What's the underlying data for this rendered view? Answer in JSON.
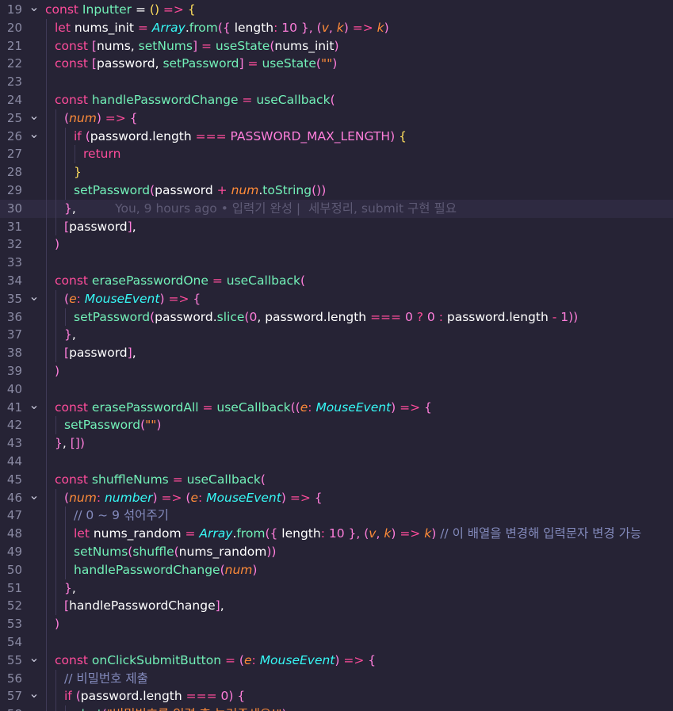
{
  "editor": {
    "blame": {
      "line": 30,
      "text": "You, 9 hours ago • 입력기 완성 |  세부정리, submit 구현 필요"
    },
    "lines": [
      {
        "n": 19,
        "fold": true,
        "indent": 0,
        "tokens": [
          [
            "k",
            "const "
          ],
          [
            "fn",
            "Inputter"
          ],
          [
            "v",
            " = "
          ],
          [
            "y",
            "()"
          ],
          [
            "k",
            " => "
          ],
          [
            "y",
            "{"
          ]
        ]
      },
      {
        "n": 20,
        "fold": false,
        "indent": 1,
        "tokens": [
          [
            "k",
            "let "
          ],
          [
            "v",
            "nums_init "
          ],
          [
            "k",
            "= "
          ],
          [
            "cls",
            "Array"
          ],
          [
            "v",
            "."
          ],
          [
            "fn",
            "from"
          ],
          [
            "pr",
            "({ "
          ],
          [
            "v",
            "length"
          ],
          [
            "k",
            ": "
          ],
          [
            "pr",
            "10 "
          ],
          [
            "pr",
            "}, "
          ],
          [
            "pr",
            "("
          ],
          [
            "p",
            "v"
          ],
          [
            "pr",
            ", "
          ],
          [
            "p",
            "k"
          ],
          [
            "pr",
            ")"
          ],
          [
            "k",
            " => "
          ],
          [
            "p",
            "k"
          ],
          [
            "pr",
            ")"
          ]
        ]
      },
      {
        "n": 21,
        "fold": false,
        "indent": 1,
        "tokens": [
          [
            "k",
            "const "
          ],
          [
            "pr",
            "["
          ],
          [
            "v",
            "nums, "
          ],
          [
            "fn",
            "setNums"
          ],
          [
            "pr",
            "]"
          ],
          [
            "k",
            " = "
          ],
          [
            "fn",
            "useState"
          ],
          [
            "pr",
            "("
          ],
          [
            "v",
            "nums_init"
          ],
          [
            "pr",
            ")"
          ]
        ]
      },
      {
        "n": 22,
        "fold": false,
        "indent": 1,
        "tokens": [
          [
            "k",
            "const "
          ],
          [
            "pr",
            "["
          ],
          [
            "v",
            "password, "
          ],
          [
            "fn",
            "setPassword"
          ],
          [
            "pr",
            "]"
          ],
          [
            "k",
            " = "
          ],
          [
            "fn",
            "useState"
          ],
          [
            "pr",
            "("
          ],
          [
            "s",
            "\"\""
          ],
          [
            "pr",
            ")"
          ]
        ]
      },
      {
        "n": 23,
        "fold": false,
        "indent": 1,
        "tokens": []
      },
      {
        "n": 24,
        "fold": false,
        "indent": 1,
        "tokens": [
          [
            "k",
            "const "
          ],
          [
            "fn",
            "handlePasswordChange"
          ],
          [
            "k",
            " = "
          ],
          [
            "fn",
            "useCallback"
          ],
          [
            "pr",
            "("
          ]
        ]
      },
      {
        "n": 25,
        "fold": true,
        "indent": 2,
        "tokens": [
          [
            "pr",
            "("
          ],
          [
            "p",
            "num"
          ],
          [
            "pr",
            ")"
          ],
          [
            "k",
            " => "
          ],
          [
            "pr",
            "{"
          ]
        ]
      },
      {
        "n": 26,
        "fold": true,
        "indent": 3,
        "tokens": [
          [
            "k",
            "if "
          ],
          [
            "pr",
            "("
          ],
          [
            "v",
            "password."
          ],
          [
            "v",
            "length"
          ],
          [
            "k",
            " === "
          ],
          [
            "pr",
            "PASSWORD_MAX_LENGTH"
          ],
          [
            "pr",
            ")"
          ],
          [
            "v",
            " "
          ],
          [
            "y",
            "{"
          ]
        ]
      },
      {
        "n": 27,
        "fold": false,
        "indent": 4,
        "tokens": [
          [
            "k",
            "return"
          ]
        ]
      },
      {
        "n": 28,
        "fold": false,
        "indent": 3,
        "tokens": [
          [
            "y",
            "}"
          ]
        ]
      },
      {
        "n": 29,
        "fold": false,
        "indent": 3,
        "tokens": [
          [
            "fn",
            "setPassword"
          ],
          [
            "pr",
            "("
          ],
          [
            "v",
            "password "
          ],
          [
            "k",
            "+ "
          ],
          [
            "p",
            "num"
          ],
          [
            "v",
            "."
          ],
          [
            "fn",
            "toString"
          ],
          [
            "pr",
            "())"
          ]
        ]
      },
      {
        "n": 30,
        "fold": false,
        "indent": 2,
        "tokens": [
          [
            "pr",
            "}"
          ],
          [
            "v",
            ","
          ]
        ]
      },
      {
        "n": 31,
        "fold": false,
        "indent": 2,
        "tokens": [
          [
            "pr",
            "["
          ],
          [
            "v",
            "password"
          ],
          [
            "pr",
            "]"
          ],
          [
            "v",
            ","
          ]
        ]
      },
      {
        "n": 32,
        "fold": false,
        "indent": 1,
        "tokens": [
          [
            "pr",
            ")"
          ]
        ]
      },
      {
        "n": 33,
        "fold": false,
        "indent": 1,
        "tokens": []
      },
      {
        "n": 34,
        "fold": false,
        "indent": 1,
        "tokens": [
          [
            "k",
            "const "
          ],
          [
            "fn",
            "erasePasswordOne"
          ],
          [
            "k",
            " = "
          ],
          [
            "fn",
            "useCallback"
          ],
          [
            "pr",
            "("
          ]
        ]
      },
      {
        "n": 35,
        "fold": true,
        "indent": 2,
        "tokens": [
          [
            "pr",
            "("
          ],
          [
            "p",
            "e"
          ],
          [
            "k",
            ": "
          ],
          [
            "cls",
            "MouseEvent"
          ],
          [
            "pr",
            ")"
          ],
          [
            "k",
            " => "
          ],
          [
            "pr",
            "{"
          ]
        ]
      },
      {
        "n": 36,
        "fold": false,
        "indent": 3,
        "tokens": [
          [
            "fn",
            "setPassword"
          ],
          [
            "pr",
            "("
          ],
          [
            "v",
            "password."
          ],
          [
            "fn",
            "slice"
          ],
          [
            "pr",
            "("
          ],
          [
            "pr",
            "0"
          ],
          [
            "v",
            ", password.length "
          ],
          [
            "k",
            "=== "
          ],
          [
            "pr",
            "0 "
          ],
          [
            "k",
            "? "
          ],
          [
            "pr",
            "0 "
          ],
          [
            "k",
            ": "
          ],
          [
            "v",
            "password.length "
          ],
          [
            "k",
            "- "
          ],
          [
            "pr",
            "1"
          ],
          [
            "pr",
            "))"
          ]
        ]
      },
      {
        "n": 37,
        "fold": false,
        "indent": 2,
        "tokens": [
          [
            "pr",
            "}"
          ],
          [
            "v",
            ","
          ]
        ]
      },
      {
        "n": 38,
        "fold": false,
        "indent": 2,
        "tokens": [
          [
            "pr",
            "["
          ],
          [
            "v",
            "password"
          ],
          [
            "pr",
            "]"
          ],
          [
            "v",
            ","
          ]
        ]
      },
      {
        "n": 39,
        "fold": false,
        "indent": 1,
        "tokens": [
          [
            "pr",
            ")"
          ]
        ]
      },
      {
        "n": 40,
        "fold": false,
        "indent": 1,
        "tokens": []
      },
      {
        "n": 41,
        "fold": true,
        "indent": 1,
        "tokens": [
          [
            "k",
            "const "
          ],
          [
            "fn",
            "erasePasswordAll"
          ],
          [
            "k",
            " = "
          ],
          [
            "fn",
            "useCallback"
          ],
          [
            "pr",
            "(("
          ],
          [
            "p",
            "e"
          ],
          [
            "k",
            ": "
          ],
          [
            "cls",
            "MouseEvent"
          ],
          [
            "pr",
            ")"
          ],
          [
            "k",
            " => "
          ],
          [
            "pr",
            "{"
          ]
        ]
      },
      {
        "n": 42,
        "fold": false,
        "indent": 2,
        "tokens": [
          [
            "fn",
            "setPassword"
          ],
          [
            "pr",
            "("
          ],
          [
            "s",
            "\"\""
          ],
          [
            "pr",
            ")"
          ]
        ]
      },
      {
        "n": 43,
        "fold": false,
        "indent": 1,
        "tokens": [
          [
            "pr",
            "}"
          ],
          [
            "v",
            ", "
          ],
          [
            "pr",
            "[])"
          ]
        ]
      },
      {
        "n": 44,
        "fold": false,
        "indent": 1,
        "tokens": []
      },
      {
        "n": 45,
        "fold": false,
        "indent": 1,
        "tokens": [
          [
            "k",
            "const "
          ],
          [
            "fn",
            "shuffleNums"
          ],
          [
            "k",
            " = "
          ],
          [
            "fn",
            "useCallback"
          ],
          [
            "pr",
            "("
          ]
        ]
      },
      {
        "n": 46,
        "fold": true,
        "indent": 2,
        "tokens": [
          [
            "pr",
            "("
          ],
          [
            "p",
            "num"
          ],
          [
            "k",
            ": "
          ],
          [
            "cls",
            "number"
          ],
          [
            "pr",
            ")"
          ],
          [
            "k",
            " => "
          ],
          [
            "pr",
            "("
          ],
          [
            "p",
            "e"
          ],
          [
            "k",
            ": "
          ],
          [
            "cls",
            "MouseEvent"
          ],
          [
            "pr",
            ")"
          ],
          [
            "k",
            " => "
          ],
          [
            "pr",
            "{"
          ]
        ]
      },
      {
        "n": 47,
        "fold": false,
        "indent": 3,
        "tokens": [
          [
            "c",
            "// 0 ~ 9 섞어주기"
          ]
        ]
      },
      {
        "n": 48,
        "fold": false,
        "indent": 3,
        "tokens": [
          [
            "k",
            "let "
          ],
          [
            "v",
            "nums_random "
          ],
          [
            "k",
            "= "
          ],
          [
            "cls",
            "Array"
          ],
          [
            "v",
            "."
          ],
          [
            "fn",
            "from"
          ],
          [
            "pr",
            "({ "
          ],
          [
            "v",
            "length"
          ],
          [
            "k",
            ": "
          ],
          [
            "pr",
            "10 "
          ],
          [
            "pr",
            "}, "
          ],
          [
            "pr",
            "("
          ],
          [
            "p",
            "v"
          ],
          [
            "pr",
            ", "
          ],
          [
            "p",
            "k"
          ],
          [
            "pr",
            ")"
          ],
          [
            "k",
            " => "
          ],
          [
            "p",
            "k"
          ],
          [
            "pr",
            ")"
          ],
          [
            "c",
            " // 이 배열을 변경해 입력문자 변경 가능"
          ]
        ]
      },
      {
        "n": 49,
        "fold": false,
        "indent": 3,
        "tokens": [
          [
            "fn",
            "setNums"
          ],
          [
            "pr",
            "("
          ],
          [
            "fn",
            "shuffle"
          ],
          [
            "pr",
            "("
          ],
          [
            "v",
            "nums_random"
          ],
          [
            "pr",
            "))"
          ]
        ]
      },
      {
        "n": 50,
        "fold": false,
        "indent": 3,
        "tokens": [
          [
            "fn",
            "handlePasswordChange"
          ],
          [
            "pr",
            "("
          ],
          [
            "p",
            "num"
          ],
          [
            "pr",
            ")"
          ]
        ]
      },
      {
        "n": 51,
        "fold": false,
        "indent": 2,
        "tokens": [
          [
            "pr",
            "}"
          ],
          [
            "v",
            ","
          ]
        ]
      },
      {
        "n": 52,
        "fold": false,
        "indent": 2,
        "tokens": [
          [
            "pr",
            "["
          ],
          [
            "v",
            "handlePasswordChange"
          ],
          [
            "pr",
            "]"
          ],
          [
            "v",
            ","
          ]
        ]
      },
      {
        "n": 53,
        "fold": false,
        "indent": 1,
        "tokens": [
          [
            "pr",
            ")"
          ]
        ]
      },
      {
        "n": 54,
        "fold": false,
        "indent": 1,
        "tokens": []
      },
      {
        "n": 55,
        "fold": true,
        "indent": 1,
        "tokens": [
          [
            "k",
            "const "
          ],
          [
            "fn",
            "onClickSubmitButton"
          ],
          [
            "k",
            " = "
          ],
          [
            "pr",
            "("
          ],
          [
            "p",
            "e"
          ],
          [
            "k",
            ": "
          ],
          [
            "cls",
            "MouseEvent"
          ],
          [
            "pr",
            ")"
          ],
          [
            "k",
            " => "
          ],
          [
            "pr",
            "{"
          ]
        ]
      },
      {
        "n": 56,
        "fold": false,
        "indent": 2,
        "tokens": [
          [
            "c",
            "// 비밀번호 제출"
          ]
        ]
      },
      {
        "n": 57,
        "fold": true,
        "indent": 2,
        "tokens": [
          [
            "k",
            "if "
          ],
          [
            "pr",
            "("
          ],
          [
            "v",
            "password.length "
          ],
          [
            "k",
            "=== "
          ],
          [
            "pr",
            "0"
          ],
          [
            "pr",
            ")"
          ],
          [
            "v",
            " "
          ],
          [
            "pr",
            "{"
          ]
        ]
      },
      {
        "n": 58,
        "fold": false,
        "indent": 3,
        "tokens": [
          [
            "fn",
            "alert"
          ],
          [
            "pr",
            "("
          ],
          [
            "s",
            "\"비밀번호를 입력 후 눌러주세요!\""
          ],
          [
            "pr",
            ")"
          ]
        ]
      }
    ]
  }
}
